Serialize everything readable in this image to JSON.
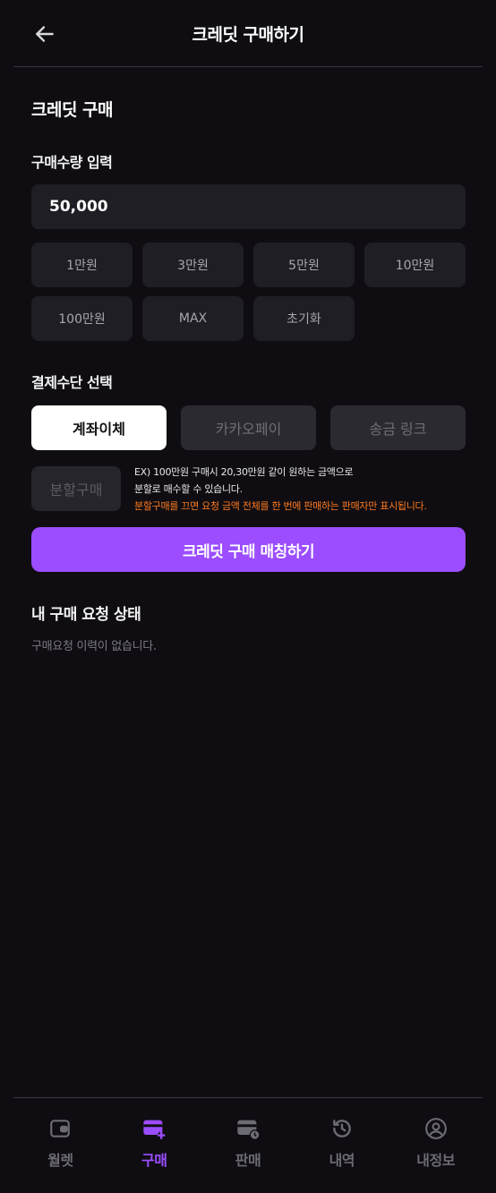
{
  "header": {
    "title": "크레딧 구매하기",
    "back_icon": "arrow-left-icon"
  },
  "purchase": {
    "section_title": "크레딧 구매",
    "quantity_label": "구매수량 입력",
    "quantity_value": "50,000",
    "quick_amounts": [
      "1만원",
      "3만원",
      "5만원",
      "10만원",
      "100만원",
      "MAX",
      "초기화"
    ]
  },
  "payment": {
    "label": "결제수단 선택",
    "methods": [
      "계좌이체",
      "카카오페이",
      "송금 링크"
    ],
    "selected": "계좌이체"
  },
  "split": {
    "button_label": "분할구매",
    "note_line1": "EX) 100만원 구매시 20,30만원 같이 원하는 금액으로",
    "note_line2": "분할로 매수할 수 있습니다.",
    "warning": "분할구매를 끄면 요청 금액 전체를 한 번에 판매하는 판매자만 표시됩니다."
  },
  "match_button": "크레딧 구매 매칭하기",
  "status": {
    "title": "내 구매 요청 상태",
    "empty_text": "구매요청 이력이 없습니다."
  },
  "tabbar": {
    "active": "구매",
    "items": [
      {
        "label": "월렛",
        "icon": "wallet-icon"
      },
      {
        "label": "구매",
        "icon": "card-plus-icon"
      },
      {
        "label": "판매",
        "icon": "card-clock-icon"
      },
      {
        "label": "내역",
        "icon": "history-icon"
      },
      {
        "label": "내정보",
        "icon": "user-circle-icon"
      }
    ]
  },
  "colors": {
    "background": "#0f0d12",
    "accent": "#9b4dff",
    "warning": "#ff7a1f",
    "surface": "#1f1e24"
  }
}
